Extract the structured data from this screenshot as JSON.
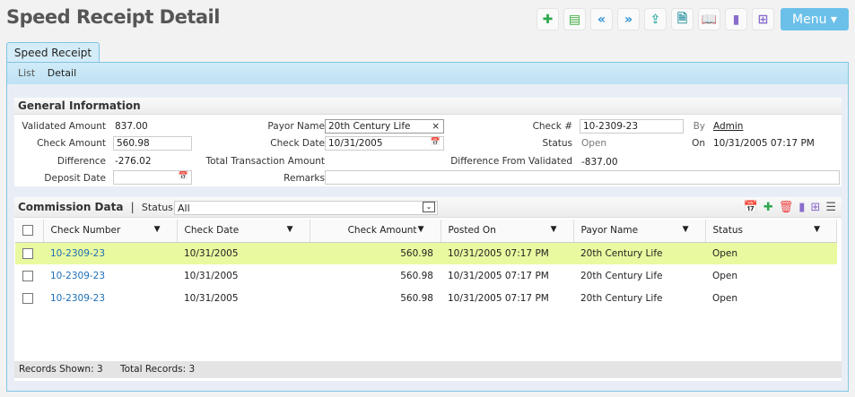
{
  "header": {
    "title": "Speed Receipt Detail",
    "menu_label": "Menu ▾",
    "toolbar": [
      {
        "icon": "add-icon",
        "glyph": "✚",
        "color": "#2fa84f"
      },
      {
        "icon": "save-icon",
        "glyph": "▤",
        "color": "#3aa83a"
      },
      {
        "icon": "first-icon",
        "glyph": "«",
        "color": "#2a8fd8"
      },
      {
        "icon": "last-icon",
        "glyph": "»",
        "color": "#2a8fd8"
      },
      {
        "icon": "upload-payment-icon",
        "glyph": "⇪",
        "color": "#3bb0a8"
      },
      {
        "icon": "document-hand-icon",
        "glyph": "🗎",
        "color": "#3a9aa8"
      },
      {
        "icon": "book-icon",
        "glyph": "📖",
        "color": "#d8a030"
      },
      {
        "icon": "document-icon",
        "glyph": "▮",
        "color": "#8a6ccc"
      },
      {
        "icon": "add-document-icon",
        "glyph": "⊞",
        "color": "#8a6ccc"
      }
    ]
  },
  "tab": "Speed Receipt",
  "subnav": [
    "List",
    "Detail"
  ],
  "general": {
    "title": "General Information",
    "validated_amount_label": "Validated Amount",
    "validated_amount": "837.00",
    "check_amount_label": "Check Amount",
    "check_amount": "560.98",
    "difference_label": "Difference",
    "difference": "-276.02",
    "deposit_date_label": "Deposit Date",
    "deposit_date": "",
    "payor_name_label": "Payor Name",
    "payor_name": "20th Century Life",
    "check_date_label": "Check Date",
    "check_date": "10/31/2005",
    "total_tx_label": "Total Transaction Amount",
    "total_tx": "",
    "remarks_label": "Remarks",
    "remarks": "",
    "check_no_label": "Check #",
    "check_no": "10-2309-23",
    "status_label": "Status",
    "status": "Open",
    "diff_validated_label": "Difference From Validated",
    "diff_validated": "-837.00",
    "by_label": "By",
    "by": "Admin",
    "on_label": "On",
    "on": "10/31/2005 07:17 PM"
  },
  "commission": {
    "title": "Commission Data",
    "status_label": "Status",
    "status_value": "All",
    "columns": [
      "Check Number",
      "Check Date",
      "Check Amount",
      "Posted On",
      "Payor Name",
      "Status"
    ],
    "rows": [
      [
        "10-2309-23",
        "10/31/2005",
        "560.98",
        "10/31/2005 07:17 PM",
        "20th Century Life",
        "Open"
      ],
      [
        "10-2309-23",
        "10/31/2005",
        "560.98",
        "10/31/2005 07:17 PM",
        "20th Century Life",
        "Open"
      ],
      [
        "10-2309-23",
        "10/31/2005",
        "560.98",
        "10/31/2005 07:17 PM",
        "20th Century Life",
        "Open"
      ]
    ],
    "records_shown": "Records Shown: 3",
    "total_records": "Total Records: 3"
  }
}
